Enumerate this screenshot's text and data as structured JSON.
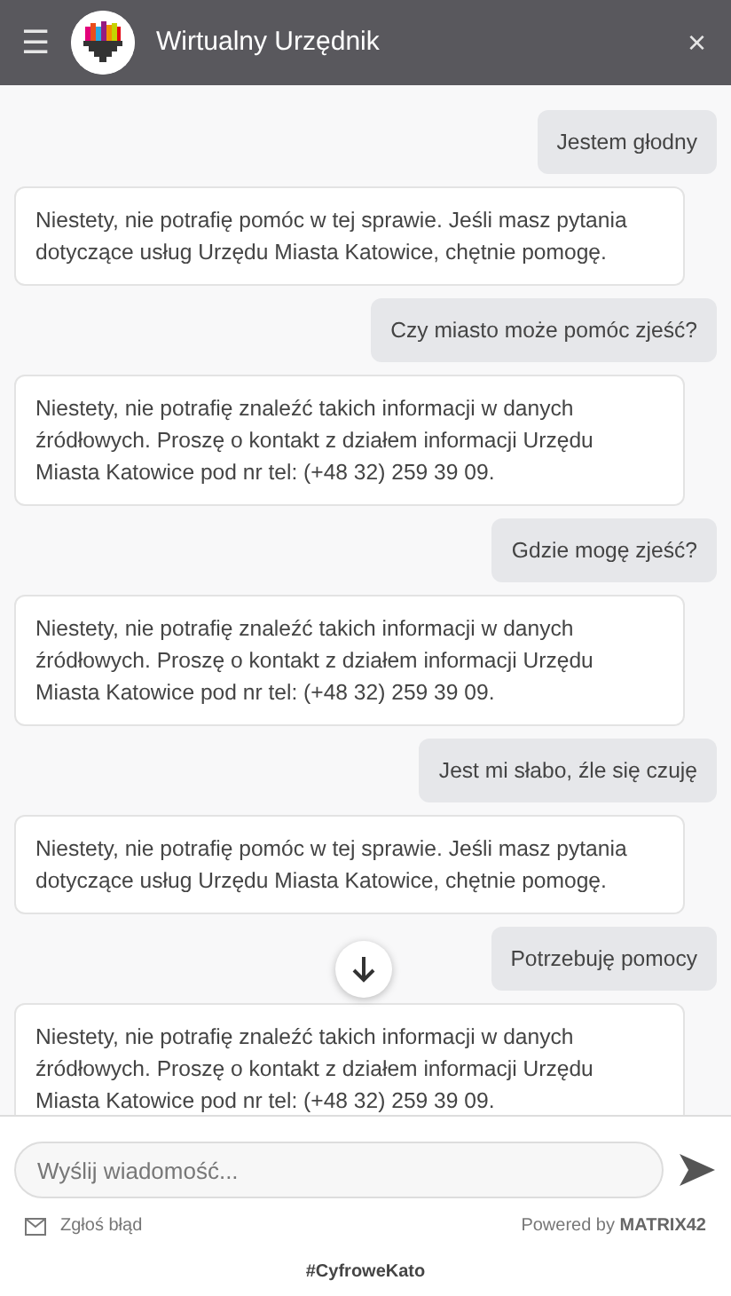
{
  "header": {
    "menu_glyph": "☰",
    "title": "Wirtualny Urzędnik",
    "close_glyph": "×"
  },
  "messages": [
    {
      "kind": "user",
      "text": "Jestem głodny"
    },
    {
      "kind": "bot",
      "text": "Niestety, nie potrafię pomóc w tej sprawie. Jeśli masz pytania dotyczące usług Urzędu Miasta Katowice, chętnie pomogę."
    },
    {
      "kind": "user",
      "text": "Czy miasto może pomóc zjeść?"
    },
    {
      "kind": "bot",
      "text": "Niestety, nie potrafię znaleźć takich informacji w danych źródłowych. Proszę o kontakt z działem informacji Urzędu Miasta Katowice pod nr tel: (+48 32) 259 39 09."
    },
    {
      "kind": "user",
      "text": "Gdzie mogę zjeść?"
    },
    {
      "kind": "bot",
      "text": "Niestety, nie potrafię znaleźć takich informacji w danych źródłowych. Proszę o kontakt z działem informacji Urzędu Miasta Katowice pod nr tel: (+48 32) 259 39 09."
    },
    {
      "kind": "user",
      "text": "Jest mi słabo, źle się czuję"
    },
    {
      "kind": "bot",
      "text": "Niestety, nie potrafię pomóc w tej sprawie. Jeśli masz pytania dotyczące usług Urzędu Miasta Katowice, chętnie pomogę."
    },
    {
      "kind": "user",
      "text": "Potrzebuję pomocy"
    },
    {
      "kind": "bot",
      "text": "Niestety, nie potrafię znaleźć takich informacji w danych źródłowych. Proszę o kontakt z działem informacji Urzędu Miasta Katowice pod nr tel: (+48 32) 259 39 09."
    }
  ],
  "composer": {
    "placeholder": "Wyślij wiadomość..."
  },
  "footer": {
    "report_link": "Zgłoś błąd",
    "powered_by": "Powered by",
    "brand": "MATRIX42",
    "hashtag": "#CyfroweKato"
  }
}
